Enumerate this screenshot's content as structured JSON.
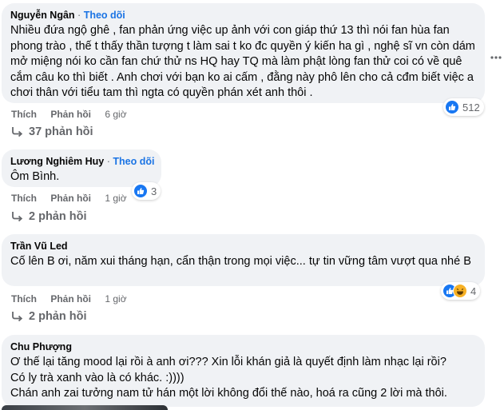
{
  "ui": {
    "follow": "Theo dõi",
    "like": "Thích",
    "reply": "Phản hồi",
    "separator": "·"
  },
  "comments": [
    {
      "author": "Nguyễn Ngân",
      "text": "Nhiều đứa ngộ ghê , fan phản ứng việc up ảnh với con giáp thứ 13 thì nói fan hùa fan phong trào , thế t thấy thần tượng t làm sai t ko đc quyền ý kiến ha gì , nghệ sĩ vn còn dám mở miệng nói ko cần fan chứ thử ns HQ hay TQ mà làm phật lòng fan thử coi có về quê cắm câu ko thì biết . Anh chơi với bạn ko ai cấm , đằng này phô lên cho cả cđm biết việc a chơi thân với tiểu tam thì ngta có quyền phán xét anh thôi .",
      "time": "6 giờ",
      "reactions": "512",
      "replies": "37 phản hồi"
    },
    {
      "author": "Lương Nghiêm Huy",
      "text": "Ôm Bình.",
      "time": "1 giờ",
      "reactions": "3",
      "replies": "2 phản hồi"
    },
    {
      "author": "Trần Vũ Led",
      "text": "Cố lên B ơi, năm xui tháng hạn, cẩn thận trong mọi việc... tự tin vững tâm vượt qua nhé B",
      "time": "1 giờ",
      "reactions": "4",
      "replies": "2 phản hồi"
    },
    {
      "author": "Chu Phượng",
      "text_lines": [
        "Ơ thế lại tăng mood lại rồi à anh ơi??? Xin lỗi khán giả là quyết định làm nhạc lại rồi?",
        "Có ly trà xanh vào là có khác. :))))",
        "Chán anh zai tưởng nam tử hán một lời không đổi thế nào, hoá ra cũng 2 lời mà thôi."
      ]
    }
  ],
  "colors": {
    "bubble": "#f0f2f5",
    "follow": "#1b74e4",
    "muted": "#65676b",
    "like": "#1877f2",
    "haha": "#f7b125"
  },
  "icons": [
    "like-icon",
    "haha-icon",
    "reply-arrow-icon",
    "more-dots-icon"
  ]
}
